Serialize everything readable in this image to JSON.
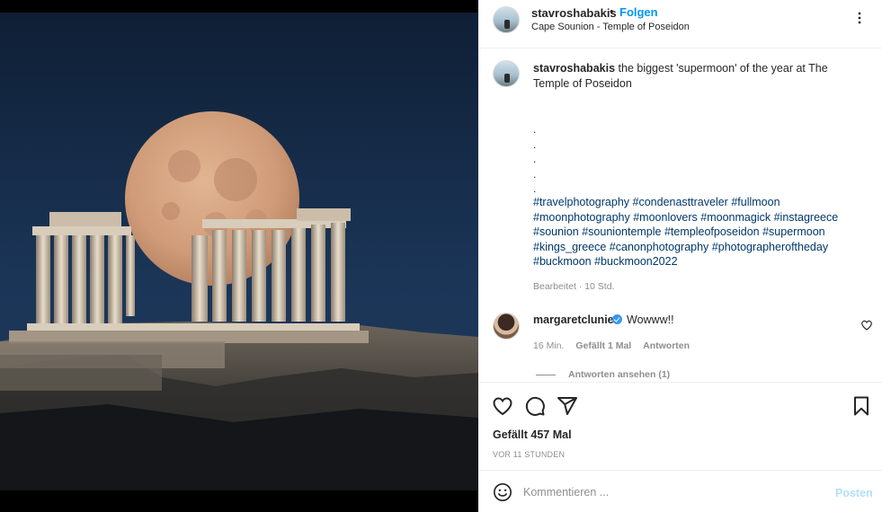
{
  "colors": {
    "accent": "#0095f6",
    "link_tag": "#00376b",
    "muted": "#8e8e8e",
    "post_disabled": "#b2dffc"
  },
  "header": {
    "username": "stavroshabakis",
    "separator": "•",
    "follow_label": "Folgen",
    "location": "Cape Sounion - Temple of Poseidon",
    "more_icon": "more-horizontal-icon"
  },
  "caption": {
    "username": "stavroshabakis",
    "text": "the biggest 'supermoon' of the year at The Temple of Poseidon",
    "dots": [
      ".",
      ".",
      ".",
      ".",
      "."
    ],
    "hashtags": [
      "#travelphotography",
      "#condenasttraveler",
      "#fullmoon",
      "#moonphotography",
      "#moonlovers",
      "#moonmagick",
      "#instagreece",
      "#sounion",
      "#souniontemple",
      "#templeofposeidon",
      "#supermoon",
      "#kings_greece",
      "#canonphotography",
      "#photographeroftheday",
      "#buckmoon",
      "#buckmoon2022"
    ],
    "edited": "Bearbeitet · 10 Std."
  },
  "reply": {
    "username": "margaretclunie",
    "verified_icon": "verified-badge-icon",
    "text": "Wowww!!",
    "time": "16 Min.",
    "likes": "Gefällt 1 Mal",
    "reply_label": "Antworten",
    "view_replies": "Antworten ansehen (1)"
  },
  "actions": {
    "icons": [
      "heart-icon",
      "comment-icon",
      "share-icon",
      "bookmark-icon"
    ],
    "likes": "Gefällt 457 Mal",
    "ago": "VOR 11 STUNDEN"
  },
  "composer": {
    "placeholder": "Kommentieren ...",
    "post_label": "Posten",
    "emoji_icon": "emoji-icon"
  }
}
